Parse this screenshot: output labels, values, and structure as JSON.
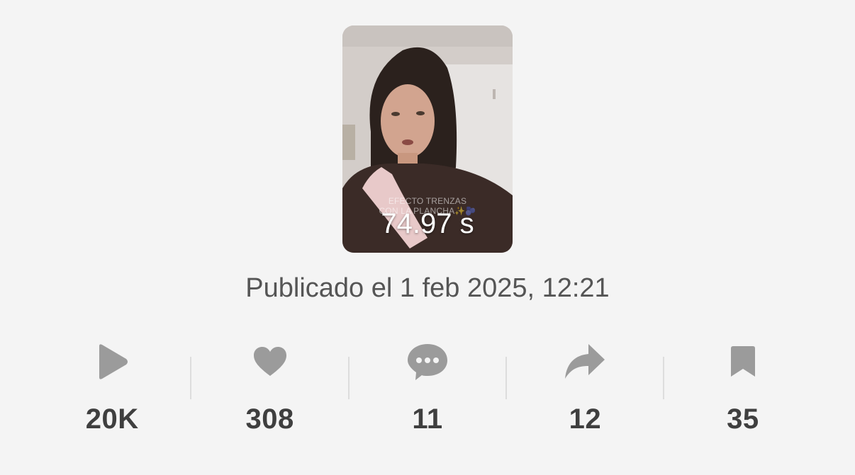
{
  "video": {
    "caption_line1": "EFECTO TRENZAS",
    "caption_line2": "CON LA PLANCHA✨🫐",
    "duration": "74.97 s"
  },
  "published": "Publicado el 1 feb 2025, 12:21",
  "stats": {
    "plays": "20K",
    "likes": "308",
    "comments": "11",
    "shares": "12",
    "saves": "35"
  },
  "icons": {
    "plays": "play-icon",
    "likes": "heart-icon",
    "comments": "comment-icon",
    "shares": "share-icon",
    "saves": "bookmark-icon"
  },
  "colors": {
    "background": "#f4f4f4",
    "icon": "#9b9b9b",
    "value_text": "#3f3f3f",
    "published_text": "#555555"
  }
}
